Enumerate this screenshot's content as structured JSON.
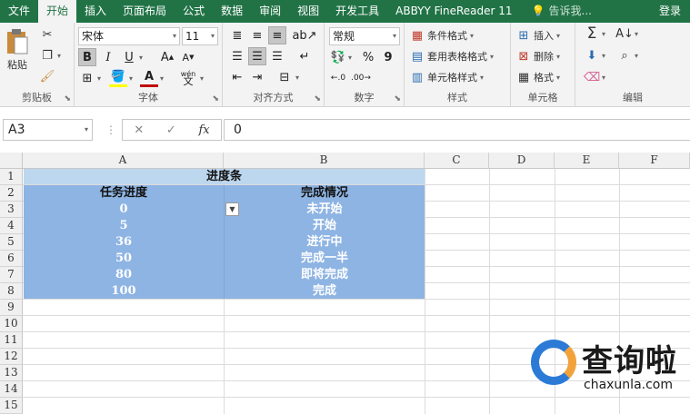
{
  "tabs": [
    "文件",
    "开始",
    "插入",
    "页面布局",
    "公式",
    "数据",
    "审阅",
    "视图",
    "开发工具",
    "ABBYY FineReader 11"
  ],
  "active_tab": "开始",
  "tell_me": "告诉我...",
  "login": "登录",
  "ribbon": {
    "clipboard": {
      "label": "剪贴板",
      "paste": "粘贴"
    },
    "font": {
      "label": "字体",
      "name": "宋体",
      "size": "11",
      "bold": "B",
      "italic": "I",
      "underline": "U",
      "grow": "A",
      "shrink": "A",
      "phonetic": "wén"
    },
    "alignment": {
      "label": "对齐方式"
    },
    "number": {
      "label": "数字",
      "format": "常规",
      "percent": "%",
      "comma": "9"
    },
    "styles": {
      "label": "样式",
      "conditional": "条件格式",
      "table": "套用表格格式",
      "cell": "单元格样式"
    },
    "cells": {
      "label": "单元格",
      "insert": "插入",
      "delete": "删除",
      "format": "格式"
    },
    "editing": {
      "label": "编辑"
    }
  },
  "formula_bar": {
    "name_box": "A3",
    "value": "0",
    "cancel": "✕",
    "enter": "✓",
    "fx": "fx"
  },
  "columns": [
    "A",
    "B",
    "C",
    "D",
    "E",
    "F"
  ],
  "rows": [
    "1",
    "2",
    "3",
    "4",
    "5",
    "6",
    "7",
    "8",
    "9",
    "10",
    "11",
    "12",
    "13",
    "14",
    "15"
  ],
  "sheet": {
    "title": "进度条",
    "headers": [
      "任务进度",
      "完成情况"
    ],
    "data": [
      [
        "0",
        "未开始"
      ],
      [
        "5",
        "开始"
      ],
      [
        "36",
        "进行中"
      ],
      [
        "50",
        "完成一半"
      ],
      [
        "80",
        "即将完成"
      ],
      [
        "100",
        "完成"
      ]
    ]
  },
  "colors": {
    "accent": "#217346",
    "title_fill": "#bdd7ee",
    "table_fill": "#8eb4e3"
  },
  "watermark": {
    "text": "查询啦",
    "url": "chaxunla.com"
  }
}
